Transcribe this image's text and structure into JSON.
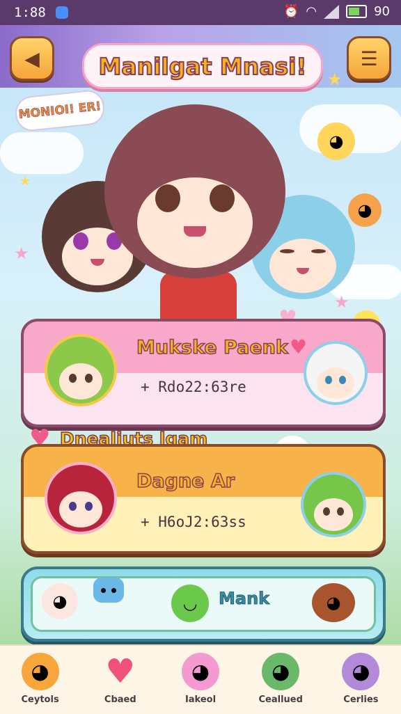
{
  "status_bar": {
    "time": "1:88",
    "battery": "90"
  },
  "header": {
    "title": "Manilgat Mnasi!"
  },
  "speech_bubble": {
    "text": "MONIOI! ER!"
  },
  "cards": [
    {
      "title": "Mukske Paenk",
      "subtitle": "+ Rdo22:63re",
      "avatar_hair": "#8cc94a",
      "right_hair": "#f5f5f5"
    },
    {
      "title": "Dagne Ar",
      "subtitle": "+ H6oJ2:63ss",
      "avatar_hair": "#b8243c",
      "right_hair": "#76c64a"
    }
  ],
  "section_label": "Dnealiuts lgam",
  "action_card": {
    "label": "Mank"
  },
  "bottom_nav": [
    {
      "label": "Ceytols",
      "icon": "bear-icon",
      "color": "#f7a63c"
    },
    {
      "label": "Cbaed",
      "icon": "heart-icon",
      "color": "#f0507a"
    },
    {
      "label": "Iakeol",
      "icon": "pink-blob-icon",
      "color": "#f59ad0"
    },
    {
      "label": "Ceallued",
      "icon": "green-frog-icon",
      "color": "#6ab86a"
    },
    {
      "label": "Cerlies",
      "icon": "purple-ghost-icon",
      "color": "#b28ad8"
    }
  ]
}
